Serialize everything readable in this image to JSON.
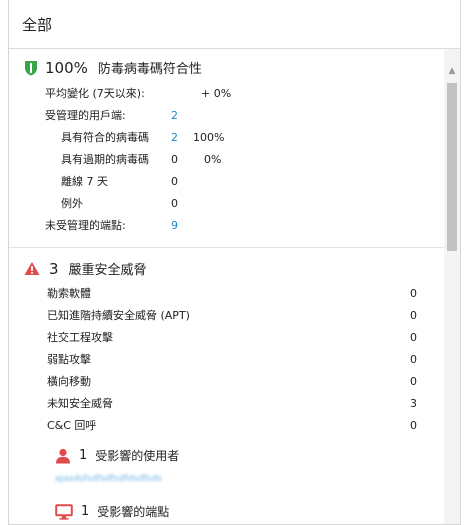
{
  "header": {
    "title": "全部"
  },
  "antivirus": {
    "percent": "100%",
    "title": "防毒病毒碼符合性",
    "icon": "shield-icon",
    "rows": [
      {
        "label": "平均變化 (7天以來):",
        "value": "+ 0%"
      },
      {
        "label": "受管理的用戶端:",
        "value": "2"
      },
      {
        "label": "具有符合的病毒碼",
        "value": "2",
        "extra": "100%"
      },
      {
        "label": "具有過期的病毒碼",
        "value": "0",
        "extra": "0%"
      },
      {
        "label": "離線 7 天",
        "value": "0"
      },
      {
        "label": "例外",
        "value": "0"
      },
      {
        "label": "未受管理的端點:",
        "value": "9"
      }
    ]
  },
  "threats": {
    "count": "3",
    "title": "嚴重安全威脅",
    "icon": "warning-triangle-icon",
    "rows": [
      {
        "label": "勒索軟體",
        "value": "0"
      },
      {
        "label": "已知進階持續安全威脅 (APT)",
        "value": "0"
      },
      {
        "label": "社交工程攻擊",
        "value": "0"
      },
      {
        "label": "弱點攻擊",
        "value": "0"
      },
      {
        "label": "橫向移動",
        "value": "0"
      },
      {
        "label": "未知安全威脅",
        "value": "3"
      },
      {
        "label": "C&C 回呼",
        "value": "0"
      }
    ],
    "affected_users": {
      "count": "1",
      "label": "受影響的使用者",
      "icon": "user-icon",
      "user_link": "ajasdsfsdfsdfsdfdsdfsds"
    },
    "affected_endpoints": {
      "count": "1",
      "label": "受影響的端點",
      "icon": "monitor-icon"
    }
  },
  "colors": {
    "shield": "#3aa64a",
    "warning": "#e04a4a",
    "link": "#1a8bc4"
  }
}
